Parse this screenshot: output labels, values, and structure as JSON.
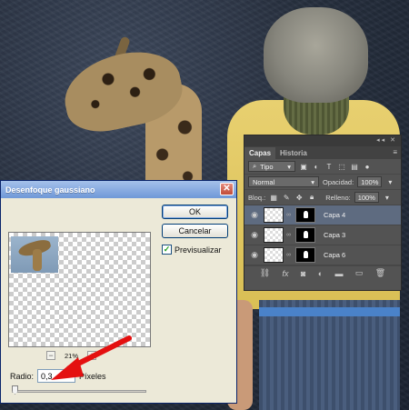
{
  "layers_panel": {
    "tabs": [
      "Capas",
      "Historia"
    ],
    "kind_filter": "Tipo",
    "blend_mode": "Normal",
    "opacity_label": "Opacidad:",
    "opacity_value": "100%",
    "lock_label": "Bloq.:",
    "fill_label": "Relleno:",
    "fill_value": "100%",
    "layers": [
      {
        "name": "Capa 4",
        "selected": true
      },
      {
        "name": "Capa 3",
        "selected": false
      },
      {
        "name": "Capa 6",
        "selected": false
      }
    ],
    "footer_icons": [
      "link-icon",
      "fx-icon",
      "mask-icon",
      "adjustment-icon",
      "group-icon",
      "new-layer-icon",
      "trash-icon"
    ]
  },
  "blur_dialog": {
    "title": "Desenfoque gaussiano",
    "ok_label": "OK",
    "cancel_label": "Cancelar",
    "preview_label": "Previsualizar",
    "preview_checked": true,
    "zoom_value": "21%",
    "radius_label": "Radio:",
    "radius_value": "0,3",
    "radius_unit": "Píxeles"
  },
  "colors": {
    "dialog_bg": "#ece9d8",
    "title_bar": "#6f98d8",
    "panel_bg": "#535353",
    "annotation_arrow": "#e41010"
  }
}
